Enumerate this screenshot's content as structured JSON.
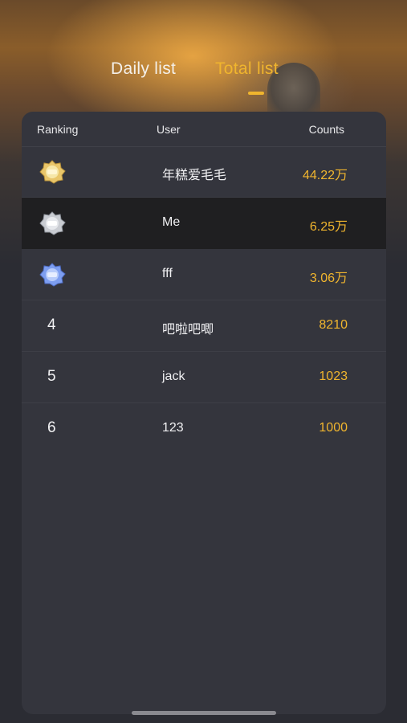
{
  "tabs": [
    {
      "label": "Daily list",
      "active": false
    },
    {
      "label": "Total list",
      "active": true
    }
  ],
  "accent_color": "#f0b52e",
  "header": {
    "ranking": "Ranking",
    "user": "User",
    "counts": "Counts"
  },
  "rows": [
    {
      "rank": "1",
      "medal": "gold-medal-icon",
      "user": "年糕爱毛毛",
      "count": "44.22万"
    },
    {
      "rank": "2",
      "medal": "silver-medal-icon",
      "user": "Me",
      "count": "6.25万",
      "highlight": true
    },
    {
      "rank": "3",
      "medal": "blue-medal-icon",
      "user": "fff",
      "count": "3.06万"
    },
    {
      "rank": "4",
      "user": "吧啦吧唧",
      "count": "8210"
    },
    {
      "rank": "5",
      "user": "jack",
      "count": "1023"
    },
    {
      "rank": "6",
      "user": "123",
      "count": "1000"
    }
  ]
}
